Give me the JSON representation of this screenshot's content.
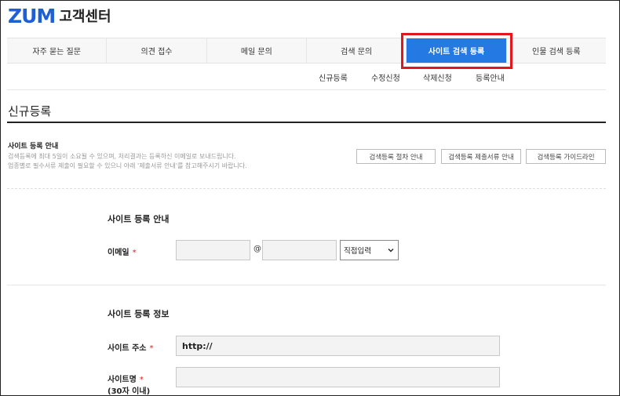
{
  "header": {
    "logo": "ZUM",
    "subtitle": "고객센터"
  },
  "gnb": {
    "tabs": [
      {
        "label": "자주 묻는 질문",
        "active": false
      },
      {
        "label": "의견 접수",
        "active": false
      },
      {
        "label": "메일 문의",
        "active": false
      },
      {
        "label": "검색 문의",
        "active": false
      },
      {
        "label": "사이트 검색 등록",
        "active": true
      },
      {
        "label": "인물 검색 등록",
        "active": false
      }
    ],
    "active_color": "#2479e3",
    "highlight_color": "#e3161e"
  },
  "sub_nav": {
    "items": [
      "신규등록",
      "수정신청",
      "삭제신청",
      "등록안내"
    ]
  },
  "page": {
    "title": "신규등록"
  },
  "info": {
    "title": "사이트 등록 안내",
    "line1": "검색등록에 최대 5일이 소요될 수 있으며, 처리결과는 등록하신 이메일로 보내드립니다.",
    "line2": "업종별로 필수서류 제출이 필요할 수 있으니 아래 '제출서류 안내'를 참고해주시기 바랍니다.",
    "buttons": [
      "검색등록 절차 안내",
      "검색등록 제출서류 안내",
      "검색등록 가이드라인"
    ]
  },
  "section1": {
    "heading": "사이트 등록 안내",
    "email": {
      "label": "이메일",
      "required_mark": "*",
      "local_value": "",
      "at": "@",
      "domain_value": "",
      "select_value": "직접입력"
    }
  },
  "section2": {
    "heading": "사이트 등록 정보",
    "url": {
      "label": "사이트 주소",
      "required_mark": "*",
      "value": "http://"
    },
    "name": {
      "label": "사이트명",
      "required_mark": "*",
      "note": "(30자 이내)",
      "value": ""
    }
  }
}
